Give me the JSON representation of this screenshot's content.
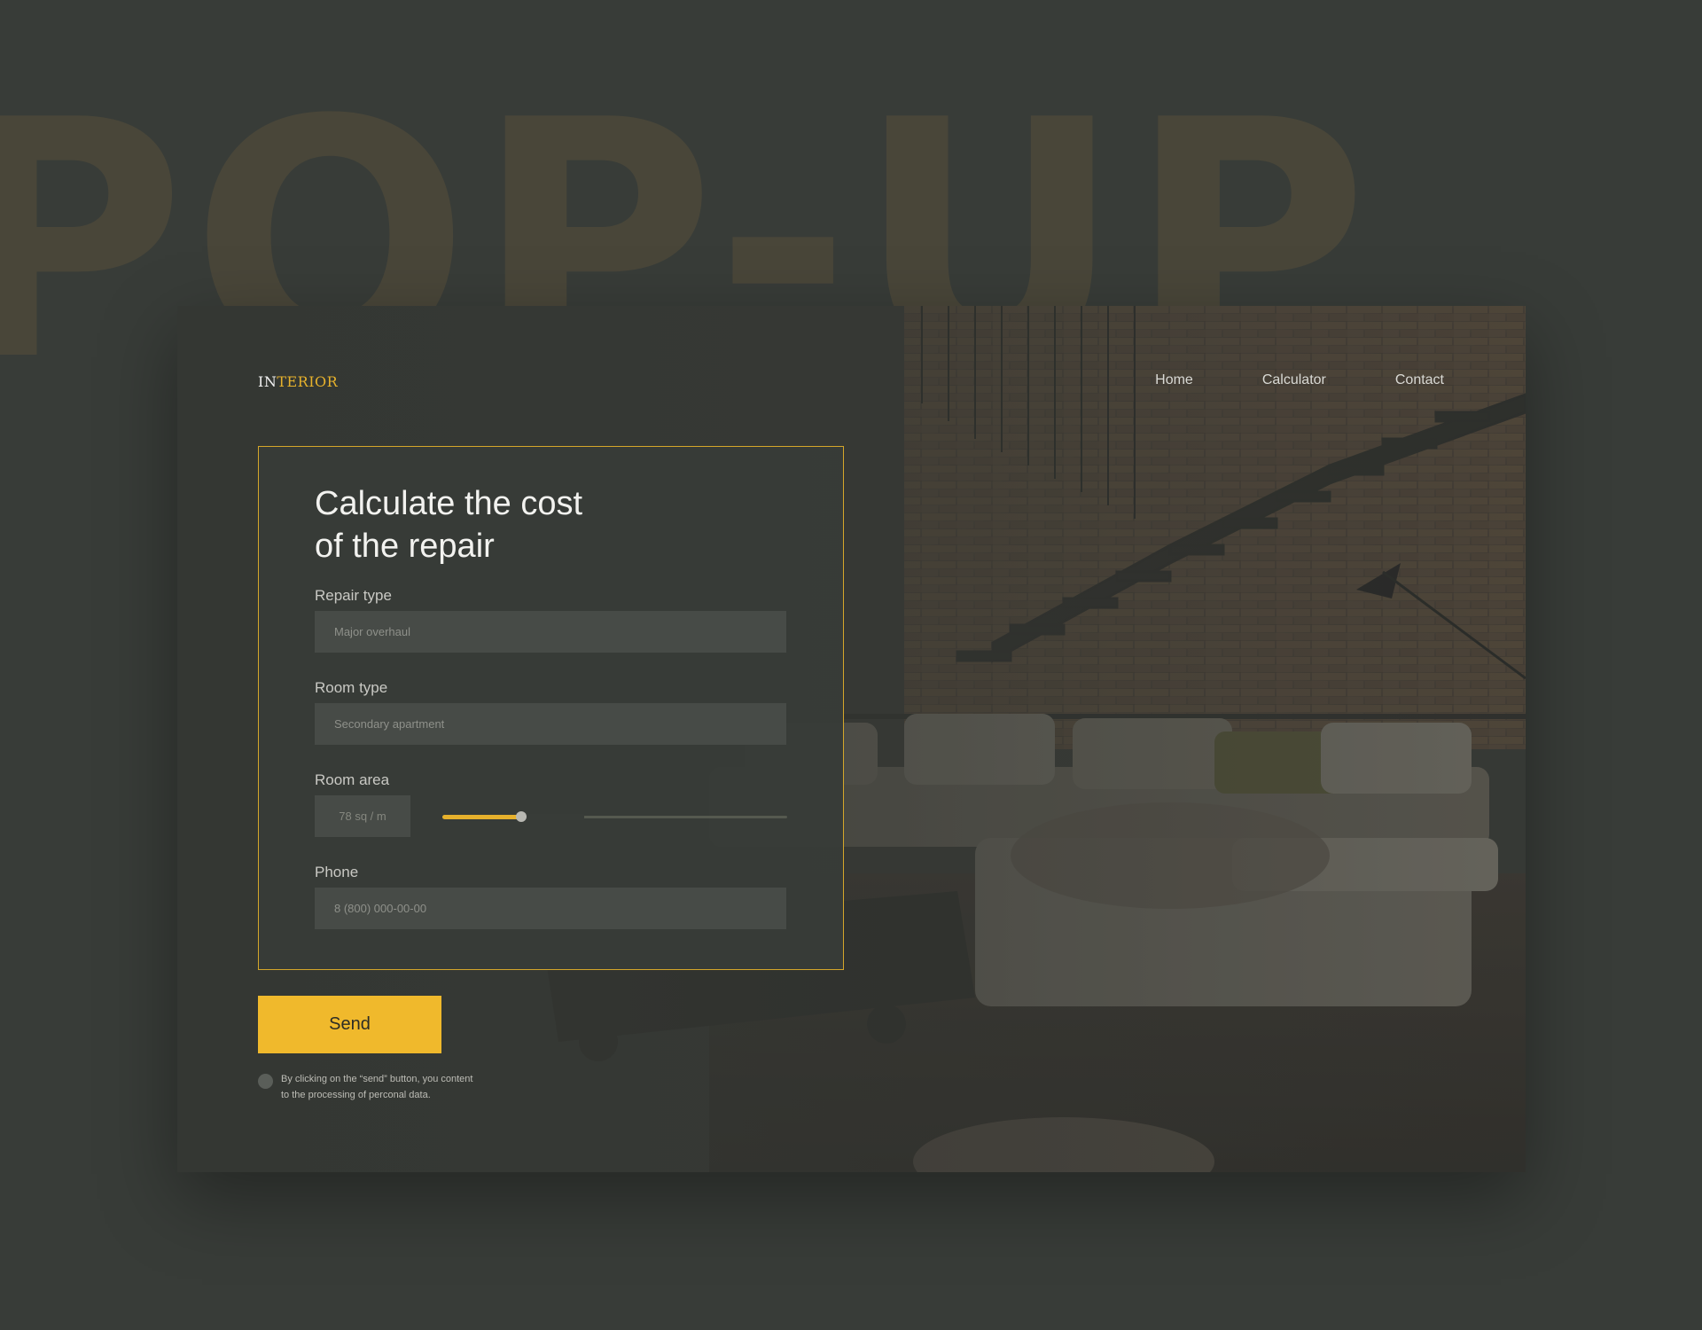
{
  "background": {
    "headline": "POP-UP"
  },
  "header": {
    "logo_prefix": "IN",
    "logo_suffix": "TERIOR",
    "nav": [
      {
        "label": "Home"
      },
      {
        "label": "Calculator"
      },
      {
        "label": "Contact"
      }
    ]
  },
  "form": {
    "title_line1": "Calculate the cost",
    "title_line2": "of the repair",
    "repair_type": {
      "label": "Repair type",
      "placeholder": "Major overhaul"
    },
    "room_type": {
      "label": "Room type",
      "placeholder": "Secondary apartment"
    },
    "room_area": {
      "label": "Room area",
      "placeholder": "78 sq / m",
      "slider_value": 0.36
    },
    "phone": {
      "label": "Phone",
      "placeholder": "8 (800) 000-00-00"
    }
  },
  "send_label": "Send",
  "consent": {
    "line1": "By clicking on the “send” button, you content",
    "line2": "to the processing of perconal data."
  },
  "colors": {
    "accent": "#f0b92c",
    "background": "#383c38",
    "panel_border": "#d4a62a"
  }
}
